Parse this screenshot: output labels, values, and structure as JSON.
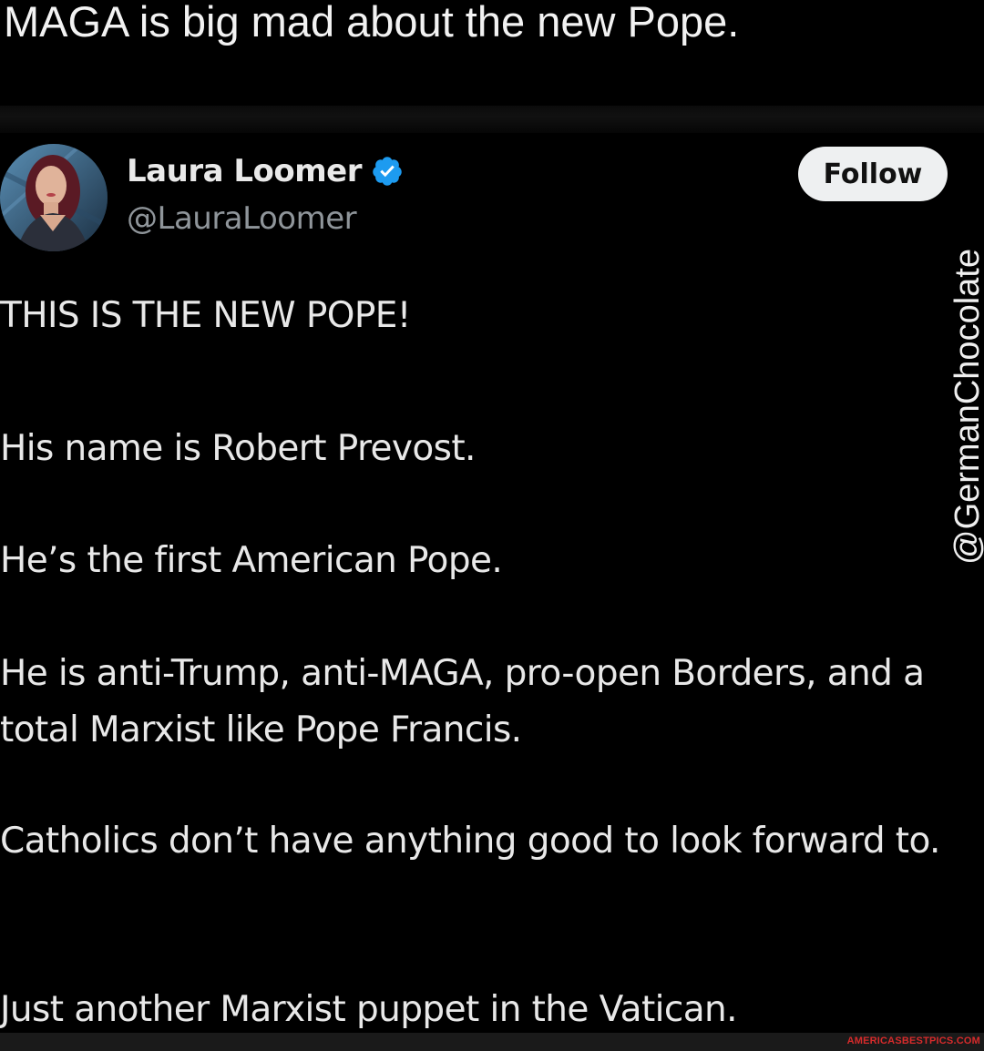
{
  "caption": "MAGA is big mad about the new Pope.",
  "tweet": {
    "author": {
      "name": "Laura Loomer",
      "handle": "@LauraLoomer",
      "verified_icon": "verified-badge-icon",
      "avatar_icon": "profile-photo"
    },
    "follow_label": "Follow",
    "paragraphs": [
      "THIS IS THE NEW POPE!",
      "His name is Robert Prevost.",
      "He’s the first American Pope.",
      "He is anti-Trump, anti-MAGA, pro-open Borders, and a total Marxist like Pope Francis.",
      "Catholics don’t have anything good to look forward to.",
      "Just another Marxist puppet in the Vatican."
    ]
  },
  "watermark": "@GermanChocolate",
  "footer_credit": "AMERICASBESTPICS.COM",
  "colors": {
    "background": "#000000",
    "text": "#e8e8e8",
    "handle": "#8f959a",
    "verified": "#1d9bf0",
    "follow_button_bg": "#eef0f1",
    "footer_credit": "#d62b2b"
  }
}
